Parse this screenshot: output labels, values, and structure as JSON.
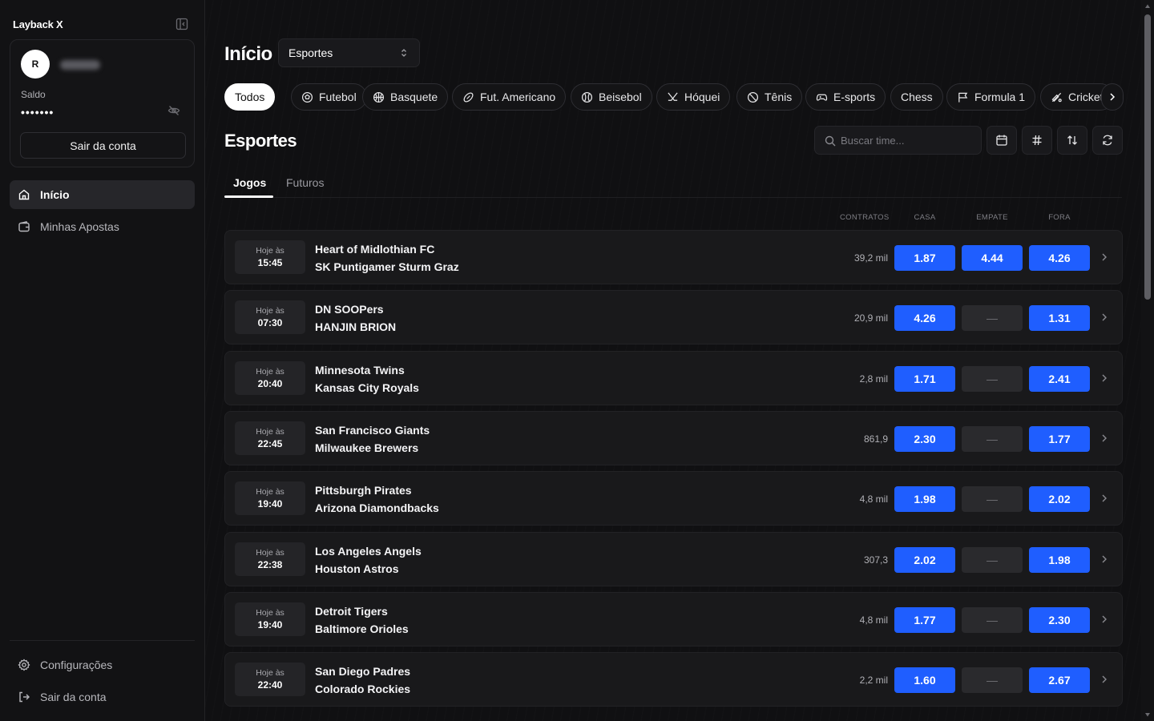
{
  "app": {
    "name": "Layback X"
  },
  "user": {
    "initial": "R",
    "balance_label": "Saldo",
    "balance_masked": "•••••••",
    "logout_label": "Sair da conta"
  },
  "nav": {
    "items": [
      {
        "label": "Início",
        "icon": "home-icon",
        "active": true
      },
      {
        "label": "Minhas Apostas",
        "icon": "wallet-icon",
        "active": false
      }
    ],
    "footer": [
      {
        "label": "Configurações",
        "icon": "gear-icon"
      },
      {
        "label": "Sair da conta",
        "icon": "logout-icon"
      }
    ]
  },
  "header": {
    "title": "Início",
    "select_value": "Esportes"
  },
  "sports_filters": [
    "Todos",
    "Futebol",
    "Basquete",
    "Fut. Americano",
    "Beisebol",
    "Hóquei",
    "Tênis",
    "E-sports",
    "Chess",
    "Formula 1",
    "Cricket"
  ],
  "section": {
    "title": "Esportes",
    "search_placeholder": "Buscar time..."
  },
  "tabs": [
    "Jogos",
    "Futuros"
  ],
  "columns": {
    "contracts": "CONTRATOS",
    "home": "CASA",
    "draw": "EMPATE",
    "away": "FORA"
  },
  "matches": [
    {
      "day": "Hoje às",
      "time": "15:45",
      "home": "Heart of Midlothian FC",
      "away": "SK Puntigamer Sturm Graz",
      "volume": "39,2 mil",
      "odds": [
        "1.87",
        "4.44",
        "4.26"
      ]
    },
    {
      "day": "Hoje às",
      "time": "07:30",
      "home": "DN SOOPers",
      "away": "HANJIN BRION",
      "volume": "20,9 mil",
      "odds": [
        "4.26",
        "—",
        "1.31"
      ]
    },
    {
      "day": "Hoje às",
      "time": "20:40",
      "home": "Minnesota Twins",
      "away": "Kansas City Royals",
      "volume": "2,8 mil",
      "odds": [
        "1.71",
        "—",
        "2.41"
      ]
    },
    {
      "day": "Hoje às",
      "time": "22:45",
      "home": "San Francisco Giants",
      "away": "Milwaukee Brewers",
      "volume": "861,9",
      "odds": [
        "2.30",
        "—",
        "1.77"
      ]
    },
    {
      "day": "Hoje às",
      "time": "19:40",
      "home": "Pittsburgh Pirates",
      "away": "Arizona Diamondbacks",
      "volume": "4,8 mil",
      "odds": [
        "1.98",
        "—",
        "2.02"
      ]
    },
    {
      "day": "Hoje às",
      "time": "22:38",
      "home": "Los Angeles Angels",
      "away": "Houston Astros",
      "volume": "307,3",
      "odds": [
        "2.02",
        "—",
        "1.98"
      ]
    },
    {
      "day": "Hoje às",
      "time": "19:40",
      "home": "Detroit Tigers",
      "away": "Baltimore Orioles",
      "volume": "4,8 mil",
      "odds": [
        "1.77",
        "—",
        "2.30"
      ]
    },
    {
      "day": "Hoje às",
      "time": "22:40",
      "home": "San Diego Padres",
      "away": "Colorado Rockies",
      "volume": "2,2 mil",
      "odds": [
        "1.60",
        "—",
        "2.67"
      ]
    }
  ],
  "colors": {
    "odd_active": "#1f5eff",
    "odd_empty": "#2a2a2d",
    "background": "#0f0f10"
  }
}
